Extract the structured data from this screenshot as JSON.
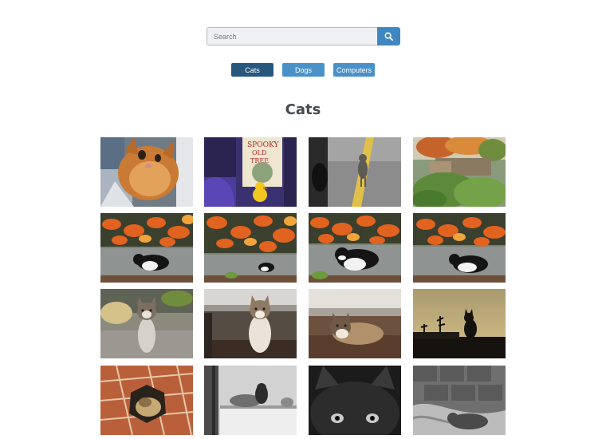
{
  "search": {
    "placeholder": "Search",
    "button_icon": "search-icon"
  },
  "categories": [
    {
      "label": "Cats",
      "active": true
    },
    {
      "label": "Dogs",
      "active": false
    },
    {
      "label": "Computers",
      "active": false
    }
  ],
  "gallery": {
    "title": "Cats",
    "images": [
      {
        "subject": "orange tabby cat selfie"
      },
      {
        "subject": "Spooky Old Tree book with toy duck"
      },
      {
        "subject": "grey cat walking on road"
      },
      {
        "subject": "garden with autumn trees"
      },
      {
        "subject": "black and white cat under autumn leaves"
      },
      {
        "subject": "black and white cat under autumn leaves"
      },
      {
        "subject": "black and white cat under autumn leaves"
      },
      {
        "subject": "black and white cat under autumn leaves"
      },
      {
        "subject": "calico kitten sitting"
      },
      {
        "subject": "calico cat under table"
      },
      {
        "subject": "calico cat lying on rug"
      },
      {
        "subject": "cat silhouette at dusk"
      },
      {
        "subject": "tabby cat in hole of tiles"
      },
      {
        "subject": "black and white photo of cats on wall"
      },
      {
        "subject": "black kitten close-up"
      },
      {
        "subject": "black and white cat sleeping on blanket"
      }
    ]
  }
}
